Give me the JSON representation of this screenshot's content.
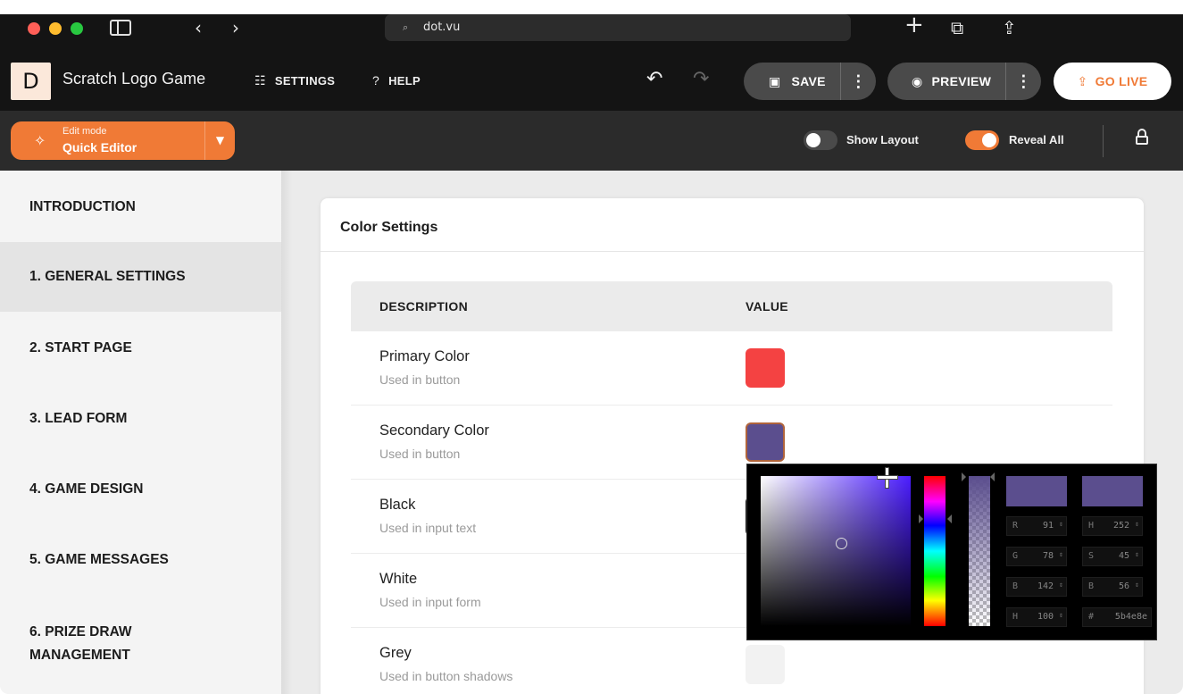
{
  "browser": {
    "url": "dot.vu"
  },
  "header": {
    "logo_letter": "D",
    "title": "Scratch Logo Game",
    "settings_label": "SETTINGS",
    "help_label": "HELP",
    "save_label": "SAVE",
    "preview_label": "PREVIEW",
    "golive_label": "GO LIVE"
  },
  "toolbar": {
    "edit_mode_caption": "Edit mode",
    "edit_mode_value": "Quick Editor",
    "show_layout_label": "Show Layout",
    "show_layout_on": false,
    "reveal_all_label": "Reveal All",
    "reveal_all_on": true
  },
  "sidebar": {
    "items": [
      {
        "label": "INTRODUCTION",
        "active": false
      },
      {
        "label": "1. GENERAL SETTINGS",
        "active": true
      },
      {
        "label": "2. START PAGE",
        "active": false
      },
      {
        "label": "3. LEAD FORM",
        "active": false
      },
      {
        "label": "4. GAME DESIGN",
        "active": false
      },
      {
        "label": "5. GAME MESSAGES",
        "active": false
      },
      {
        "label": "6. PRIZE DRAW",
        "label2": "MANAGEMENT",
        "active": false
      }
    ]
  },
  "color_settings": {
    "title": "Color Settings",
    "columns": [
      "DESCRIPTION",
      "VALUE"
    ],
    "rows": [
      {
        "name": "Primary Color",
        "desc": "Used in button",
        "color": "#f44242"
      },
      {
        "name": "Secondary Color",
        "desc": "Used in button",
        "color": "#5b4e8e"
      },
      {
        "name": "Black",
        "desc": "Used in input text",
        "color": "#1a1a1a"
      },
      {
        "name": "White",
        "desc": "Used in input form",
        "color": "#ffffff"
      },
      {
        "name": "Grey",
        "desc": "Used in button shadows",
        "color": "#f2f2f2"
      }
    ]
  },
  "color_picker": {
    "selected_color": "#5b4e8e",
    "fields": {
      "r": {
        "label": "R",
        "value": "91"
      },
      "g": {
        "label": "G",
        "value": "78"
      },
      "b": {
        "label": "B",
        "value": "142"
      },
      "a": {
        "label": "H",
        "value": "100"
      },
      "h": {
        "label": "H",
        "value": "252"
      },
      "s": {
        "label": "S",
        "value": "45"
      },
      "v": {
        "label": "B",
        "value": "56"
      },
      "hex": {
        "label": "#",
        "value": "5b4e8e"
      }
    }
  }
}
